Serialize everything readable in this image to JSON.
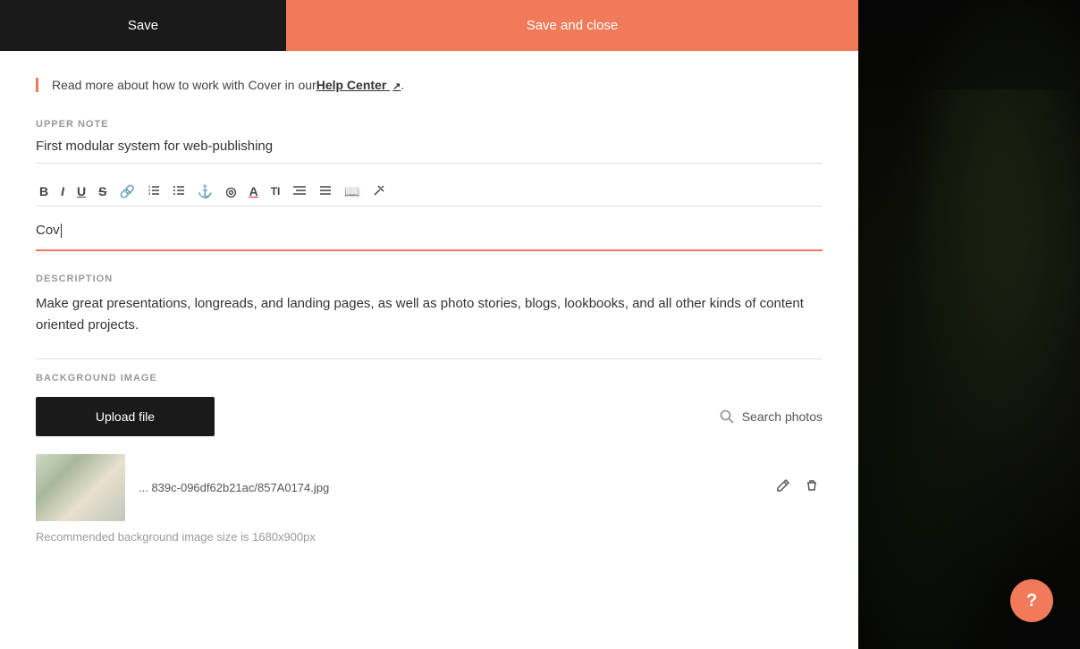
{
  "toolbar": {
    "save_label": "Save",
    "save_close_label": "Save and close"
  },
  "info_banner": {
    "text_before": "Read more about how to work with Cover in our ",
    "link_text": "Help Center",
    "text_after": "."
  },
  "upper_note": {
    "label": "UPPER NOTE",
    "value": "First modular system for web-publishing"
  },
  "editor": {
    "content": "Cov"
  },
  "rte": {
    "buttons": [
      "B",
      "I",
      "U",
      "S",
      "🔗",
      "≡",
      "≡",
      "⛓",
      "◎",
      "A",
      "TI",
      "⇤⇥",
      "≡",
      "📖",
      "✕"
    ]
  },
  "description": {
    "label": "DESCRIPTION",
    "value": "Make great presentations, longreads, and landing pages, as well as photo stories, blogs, lookbooks, and all other kinds of content oriented projects."
  },
  "background_image": {
    "label": "BACKGROUND IMAGE",
    "upload_label": "Upload file",
    "search_label": "Search photos",
    "filename": "... 839c-096df62b21ac/857A0174.jpg",
    "recommended_text": "Recommended background image size is 1680x900px"
  },
  "help": {
    "label": "?"
  }
}
